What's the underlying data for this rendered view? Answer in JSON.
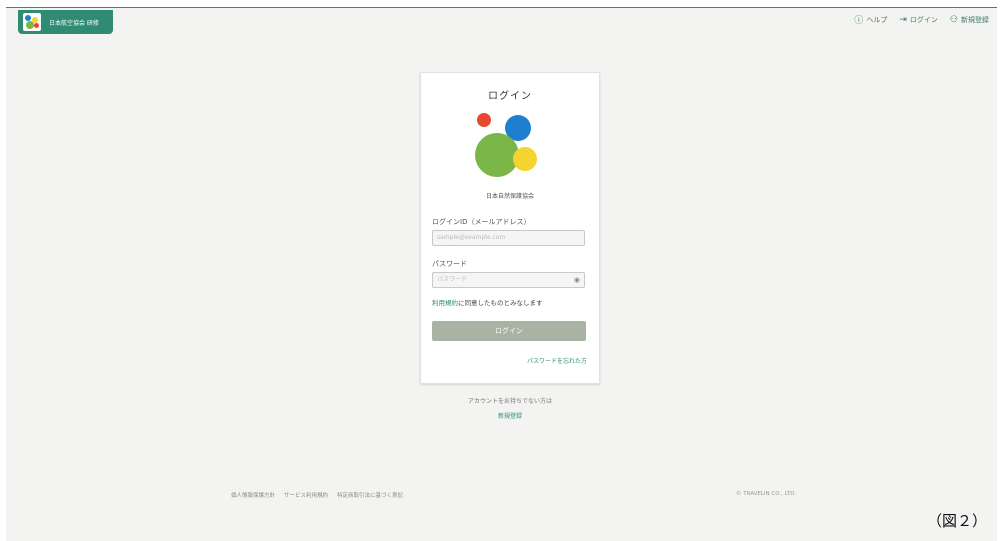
{
  "header": {
    "brand_text": "日本航空協会 研修",
    "nav": {
      "help": "ヘルプ",
      "login": "ログイン",
      "register": "新規登録"
    }
  },
  "card": {
    "title": "ログイン",
    "org_name": "日本自然保護協会",
    "login_id_label": "ログインID（メールアドレス）",
    "login_id_placeholder": "sample@example.com",
    "password_label": "パスワード",
    "password_placeholder": "パスワード",
    "terms_link": "利用規約",
    "terms_suffix": "に同意したものとみなします",
    "login_button": "ログイン",
    "forgot_link": "パスワードを忘れた方"
  },
  "below_card": {
    "no_account": "アカウントをお持ちでない方は",
    "register_link": "新規登録"
  },
  "footer": {
    "links": [
      "個人情報保護方針",
      "サービス利用規約",
      "特定商取引法に基づく表記"
    ],
    "copyright": "© TRAVELIN CO., LTD."
  },
  "figure_label": "（図２）",
  "colors": {
    "brand_green": "#2f8c72",
    "button_gray": "#a8b3a4",
    "logo_red": "#e8482e",
    "logo_blue": "#1e7fd0",
    "logo_green": "#7ab648",
    "logo_yellow": "#f5d430"
  }
}
